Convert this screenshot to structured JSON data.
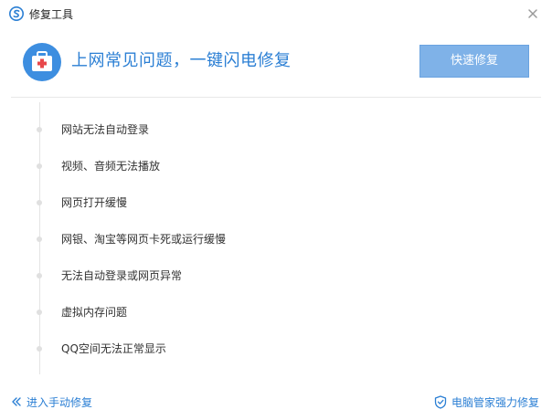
{
  "window": {
    "title": "修复工具"
  },
  "header": {
    "title": "上网常见问题，一键闪电修复",
    "quick_fix_label": "快速修复"
  },
  "issues": [
    {
      "label": "网站无法自动登录"
    },
    {
      "label": "视频、音频无法播放"
    },
    {
      "label": "网页打开缓慢"
    },
    {
      "label": "网银、淘宝等网页卡死或运行缓慢"
    },
    {
      "label": "无法自动登录或网页异常"
    },
    {
      "label": "虚拟内存问题"
    },
    {
      "label": "QQ空间无法正常显示"
    }
  ],
  "footer": {
    "manual_fix_label": "进入手动修复",
    "guard_fix_label": "电脑管家强力修复"
  },
  "colors": {
    "accent": "#2b7fd4",
    "button": "#7fb2e8",
    "icon_bg": "#3d8ee0"
  },
  "icons": {
    "app_logo": "browser-logo-icon",
    "close": "close-icon",
    "toolkit": "first-aid-kit-icon",
    "manual": "double-chevron-left-icon",
    "guard": "shield-icon"
  }
}
